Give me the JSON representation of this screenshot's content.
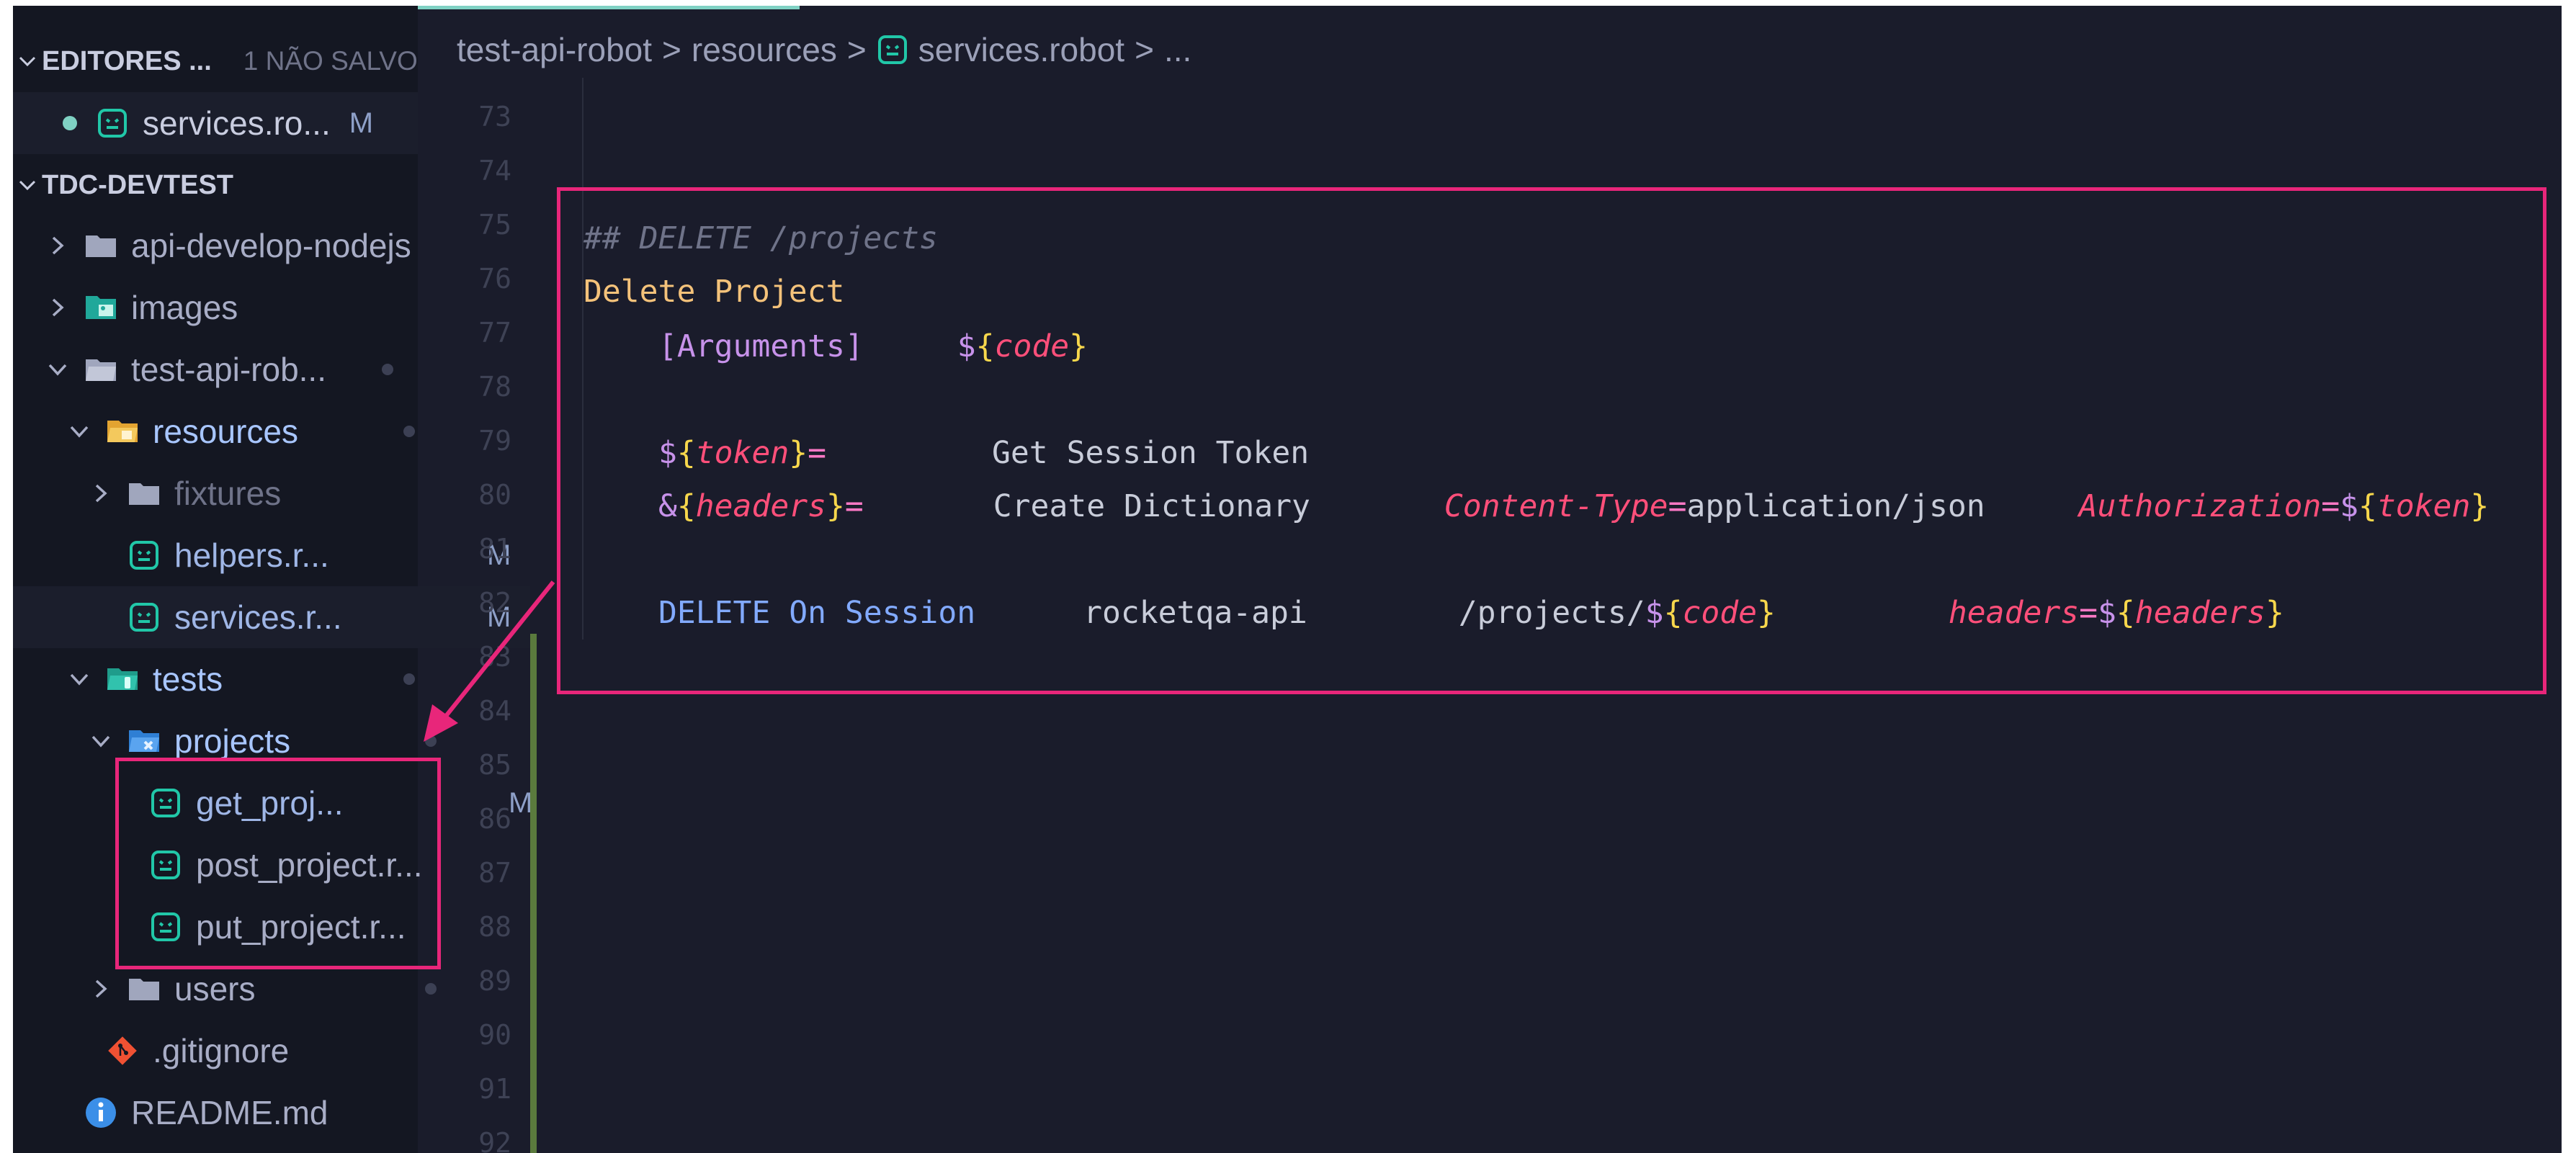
{
  "explorer": {
    "open_editors_title": "EDITORES ...",
    "open_editors_unsaved": "1 NÃO SALVO",
    "open_file": {
      "name": "services.ro...",
      "badge": "M"
    },
    "workspace_title": "TDC-DEVTEST",
    "items": [
      {
        "name": "api-develop-nodejs"
      },
      {
        "name": "images"
      },
      {
        "name": "test-api-rob..."
      },
      {
        "name": "resources"
      },
      {
        "name": "fixtures"
      },
      {
        "name": "helpers.r...",
        "badge": "M"
      },
      {
        "name": "services.r...",
        "badge": "M"
      },
      {
        "name": "tests"
      },
      {
        "name": "projects"
      },
      {
        "name": "get_proj...",
        "badge": "M"
      },
      {
        "name": "post_project.r..."
      },
      {
        "name": "put_project.r..."
      },
      {
        "name": "users"
      },
      {
        "name": ".gitignore"
      },
      {
        "name": "README.md"
      }
    ]
  },
  "breadcrumb": {
    "parts": [
      "test-api-robot",
      "resources",
      "services.robot",
      "..."
    ],
    "sep": ">"
  },
  "line_numbers": [
    "73",
    "74",
    "75",
    "76",
    "77",
    "78",
    "79",
    "80",
    "81",
    "82",
    "83",
    "84",
    "85",
    "86",
    "87",
    "88",
    "89",
    "90",
    "91",
    "92"
  ],
  "code": {
    "l75": "## DELETE /projects",
    "l76": "Delete Project",
    "l77": {
      "arguments": "[Arguments]",
      "dollar": "$",
      "open": "{",
      "var": "code",
      "close": "}"
    },
    "l79": {
      "prefix": "$",
      "open": "{",
      "var": "token",
      "close": "}",
      "eq": "=",
      "keyword": "Get Session Token"
    },
    "l80": {
      "prefix": "&",
      "open": "{",
      "var": "headers",
      "close": "}",
      "eq": "=",
      "keyword": "Create Dictionary",
      "arg1_name": "Content-Type",
      "arg1_eq": "=",
      "arg1_value": "application/json",
      "arg2_name": "Authorization",
      "arg2_eq": "=",
      "arg2_dollar": "$",
      "arg2_open": "{",
      "arg2_var": "token",
      "arg2_close": "}"
    },
    "l82": {
      "keyword": "DELETE On Session",
      "alias": "rocketqa-api",
      "path": "/projects/",
      "p_dollar": "$",
      "p_open": "{",
      "p_var": "code",
      "p_close": "}",
      "h_name": "headers",
      "h_eq": "=",
      "h_dollar": "$",
      "h_open": "{",
      "h_var": "headers",
      "h_close": "}"
    }
  },
  "colors": {
    "highlight": "#e8267a",
    "accent": "#7fd1c3",
    "git_modified": "#5a7a3d"
  }
}
